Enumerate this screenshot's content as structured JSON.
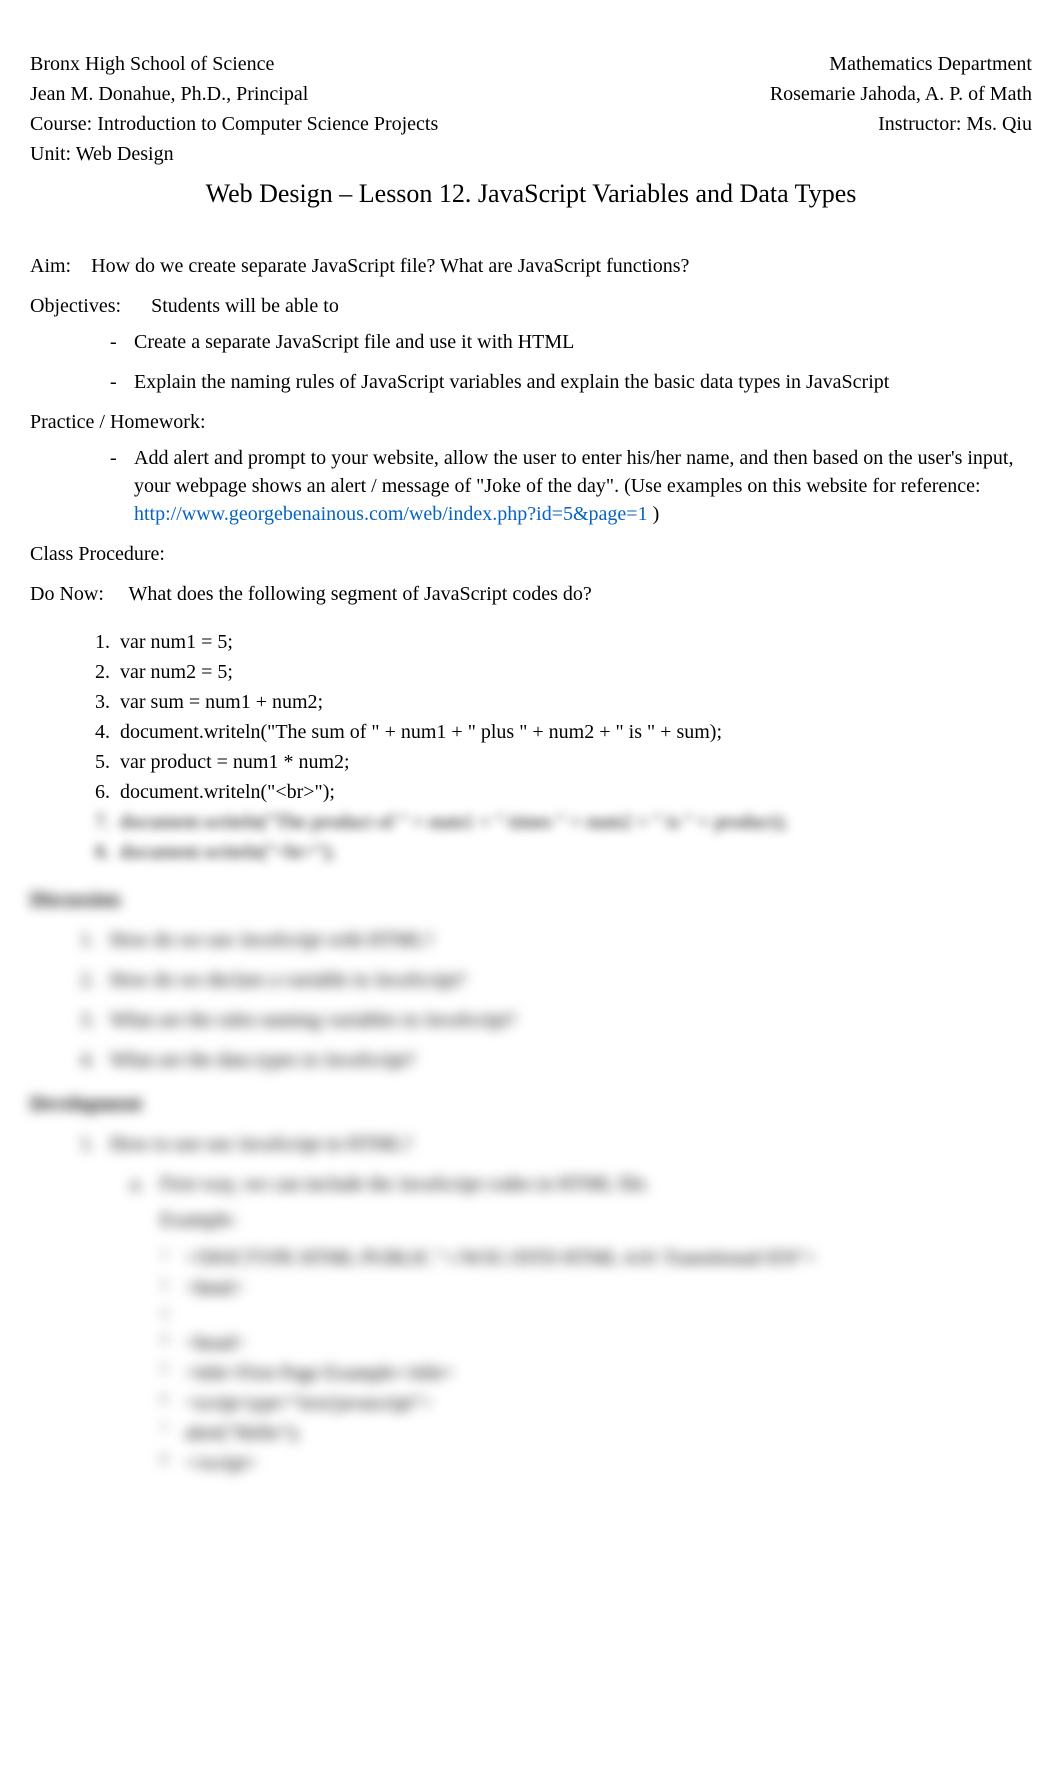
{
  "header": {
    "school": "Bronx High School of Science",
    "department": "Mathematics Department",
    "principal": "Jean M. Donahue, Ph.D., Principal",
    "ap": "Rosemarie Jahoda, A. P. of Math",
    "course": "Course: Introduction to Computer Science Projects",
    "instructor": "Instructor: Ms. Qiu",
    "unit": "Unit: Web Design"
  },
  "title": "Web Design – Lesson 12. JavaScript Variables and Data Types",
  "aim": {
    "label": "Aim:",
    "text": "How do we create separate JavaScript file? What are JavaScript functions?"
  },
  "objectives": {
    "label": "Objectives:",
    "intro": "Students will be able to",
    "items": [
      "Create a separate JavaScript file and use it with HTML",
      "Explain the naming rules of JavaScript variables and explain the basic data types in JavaScript"
    ]
  },
  "practice": {
    "label": "Practice / Homework:",
    "items": [
      {
        "text_before": "Add alert and prompt to your website, allow the user to enter his/her name, and then based on the user's input, your webpage shows an alert / message of \"Joke of the day\". (Use examples on this website for reference:    ",
        "link": "http://www.georgebenainous.com/web/index.php?id=5&page=1",
        "text_after": "       )"
      }
    ]
  },
  "class_procedure": {
    "label": "Class Procedure:"
  },
  "do_now": {
    "label": "Do Now:",
    "text": "What does the following segment of JavaScript codes do?",
    "code": [
      "var num1 = 5;",
      "var num2 = 5;",
      "var sum = num1 + num2;",
      "document.writeln(\"The sum of \" + num1 + \" plus \" + num2 + \" is \" + sum);",
      "var product = num1 * num2;",
      "document.writeln(\"<br>\");",
      "document.writeln(\"The product of \" + num1 + \" times \" + num2 + \" is \" + product);",
      "document.writeln(\"<br>\");"
    ]
  },
  "blurred": {
    "discussion_heading": "Discussion",
    "discussion_items": [
      "How do we use JavaScript with HTML?",
      "How do we declare a variable in JavaScript?",
      "What are the rules naming variables in JavaScript?",
      "What are the data types in JavaScript?"
    ],
    "development_heading": "Development",
    "development_items": [
      "How to use use JavaScript in HTML?"
    ],
    "sub_item_marker": "a.",
    "sub_item_text": "First way, we can include the JavaScript codes in HTML file.",
    "example_label": "Example:",
    "example_code": [
      "<!DOCTYPE HTML PUBLIC \"-//W3C//DTD HTML 4.01 Transitional//EN\">",
      "<html>",
      "",
      "<head>",
      "    <title>First Page Example</title>",
      "    <script type=\"text/javascript\">",
      "        alert(\"Hello\");",
      "    </script>"
    ]
  }
}
